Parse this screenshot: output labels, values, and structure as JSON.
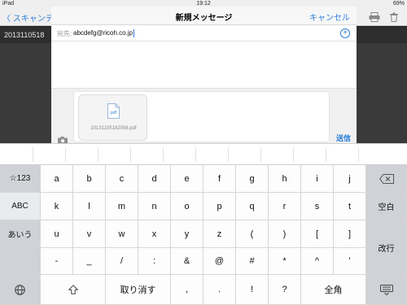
{
  "status_bar": {
    "carrier": "iPad",
    "time": "19:12",
    "battery": "69%"
  },
  "background_app": {
    "back_label": "〈 スキャンデー",
    "file_name": "2013110518"
  },
  "compose": {
    "title": "新規メッセージ",
    "cancel_label": "キャンセル",
    "to_label": "宛先:",
    "to_value": "abcdefg@ricoh.co.jp",
    "attachment_type": "pdf",
    "attachment_name": "20131105182058.pdf",
    "send_label": "送信"
  },
  "keyboard": {
    "row1": [
      "☆123",
      "a",
      "b",
      "c",
      "d",
      "e",
      "f",
      "g",
      "h",
      "i",
      "j"
    ],
    "row2": [
      "ABC",
      "k",
      "l",
      "m",
      "n",
      "o",
      "p",
      "q",
      "r",
      "s",
      "t",
      "空白"
    ],
    "row3": [
      "あいう",
      "u",
      "v",
      "w",
      "x",
      "y",
      "z",
      "(",
      ")",
      "[",
      "]",
      "改行"
    ],
    "row4": [
      "-",
      "_",
      "/",
      ":",
      "&",
      "@",
      "#",
      "*",
      "^",
      "'"
    ],
    "row5": [
      "取り消す",
      ",",
      ".",
      "!",
      "?",
      "全角"
    ]
  },
  "colors": {
    "accent": "#2b7fd8",
    "key_function": "#cfd2d6",
    "key_normal": "#fdfdfd"
  }
}
